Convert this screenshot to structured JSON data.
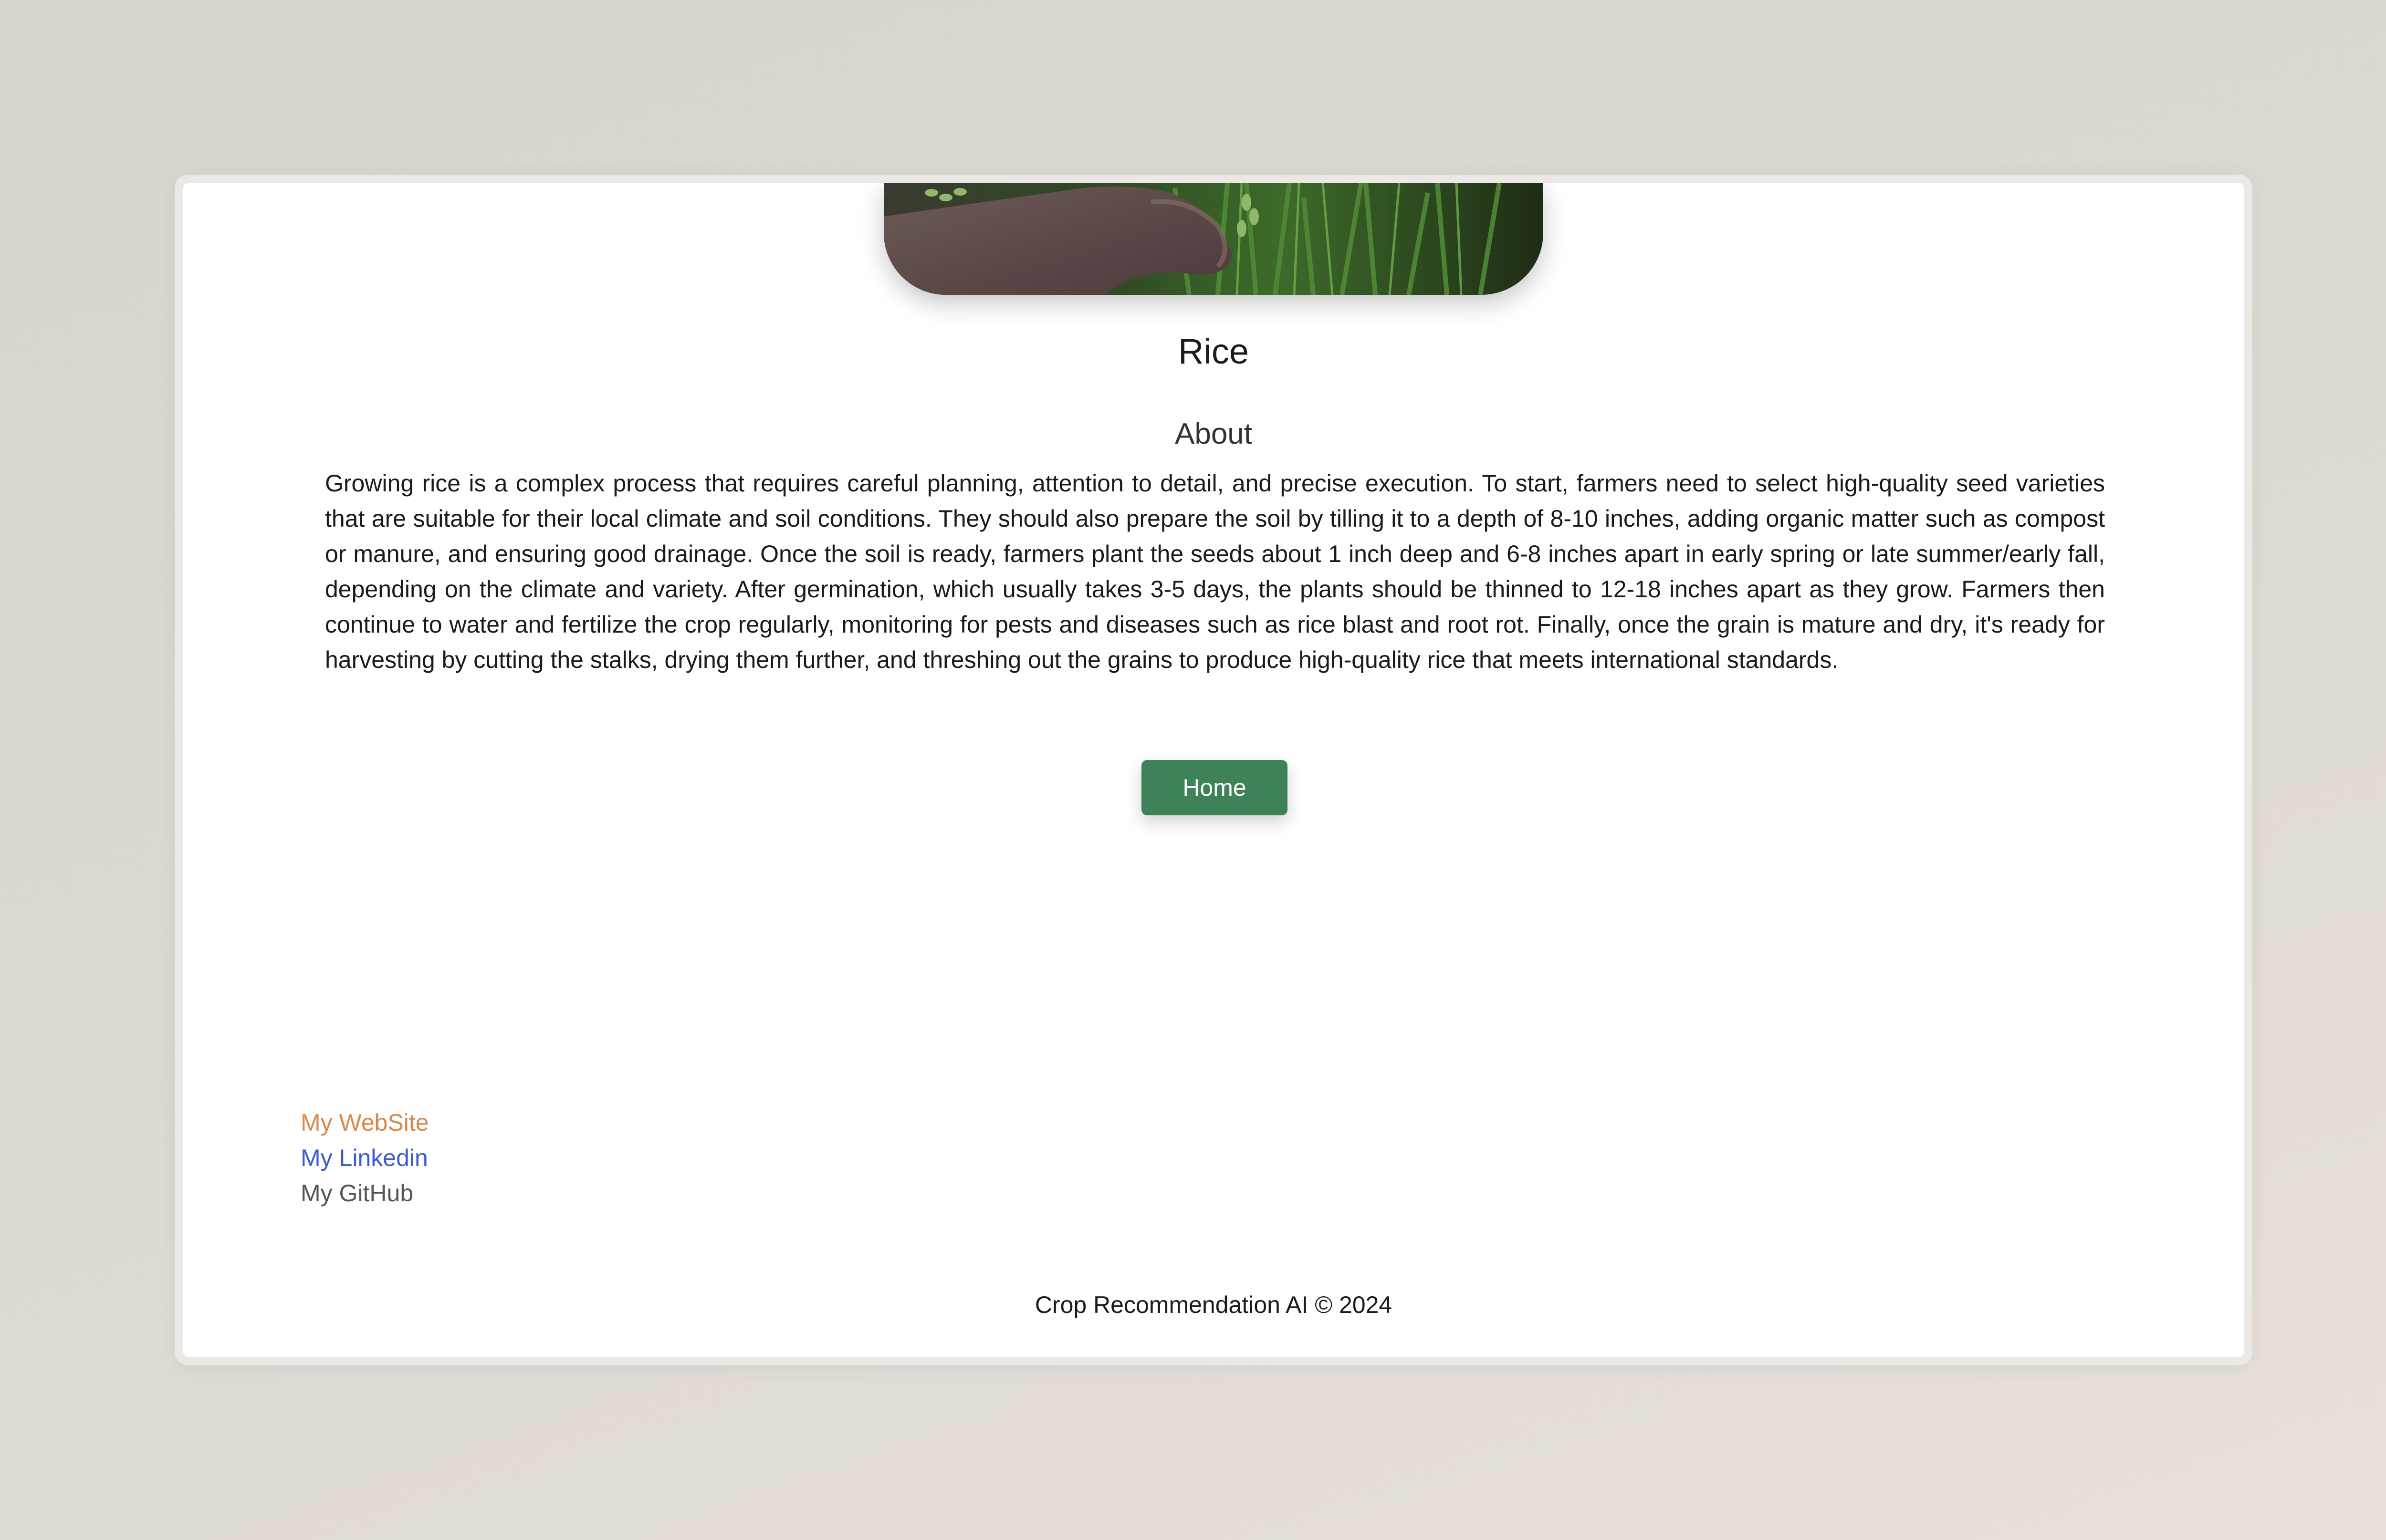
{
  "page": {
    "title": "Rice",
    "hero_image_alt": "Hand holding rice plant stalks",
    "about_heading": "About",
    "about_text": "Growing rice is a complex process that requires careful planning, attention to detail, and precise execution. To start, farmers need to select high-quality seed varieties that are suitable for their local climate and soil conditions. They should also prepare the soil by tilling it to a depth of 8-10 inches, adding organic matter such as compost or manure, and ensuring good drainage. Once the soil is ready, farmers plant the seeds about 1 inch deep and 6-8 inches apart in early spring or late summer/early fall, depending on the climate and variety. After germination, which usually takes 3-5 days, the plants should be thinned to 12-18 inches apart as they grow. Farmers then continue to water and fertilize the crop regularly, monitoring for pests and diseases such as rice blast and root rot. Finally, once the grain is mature and dry, it's ready for harvesting by cutting the stalks, drying them further, and threshing out the grains to produce high-quality rice that meets international standards.",
    "home_button_label": "Home"
  },
  "links": {
    "website": "My WebSite",
    "linkedin": "My Linkedin",
    "github": "My GitHub"
  },
  "footer": {
    "text": "Crop Recommendation AI © 2024"
  },
  "colors": {
    "accent_green": "#3d8259",
    "website_link": "#d88a4c",
    "linkedin_link": "#3b5bd0",
    "github_link": "#555555"
  }
}
